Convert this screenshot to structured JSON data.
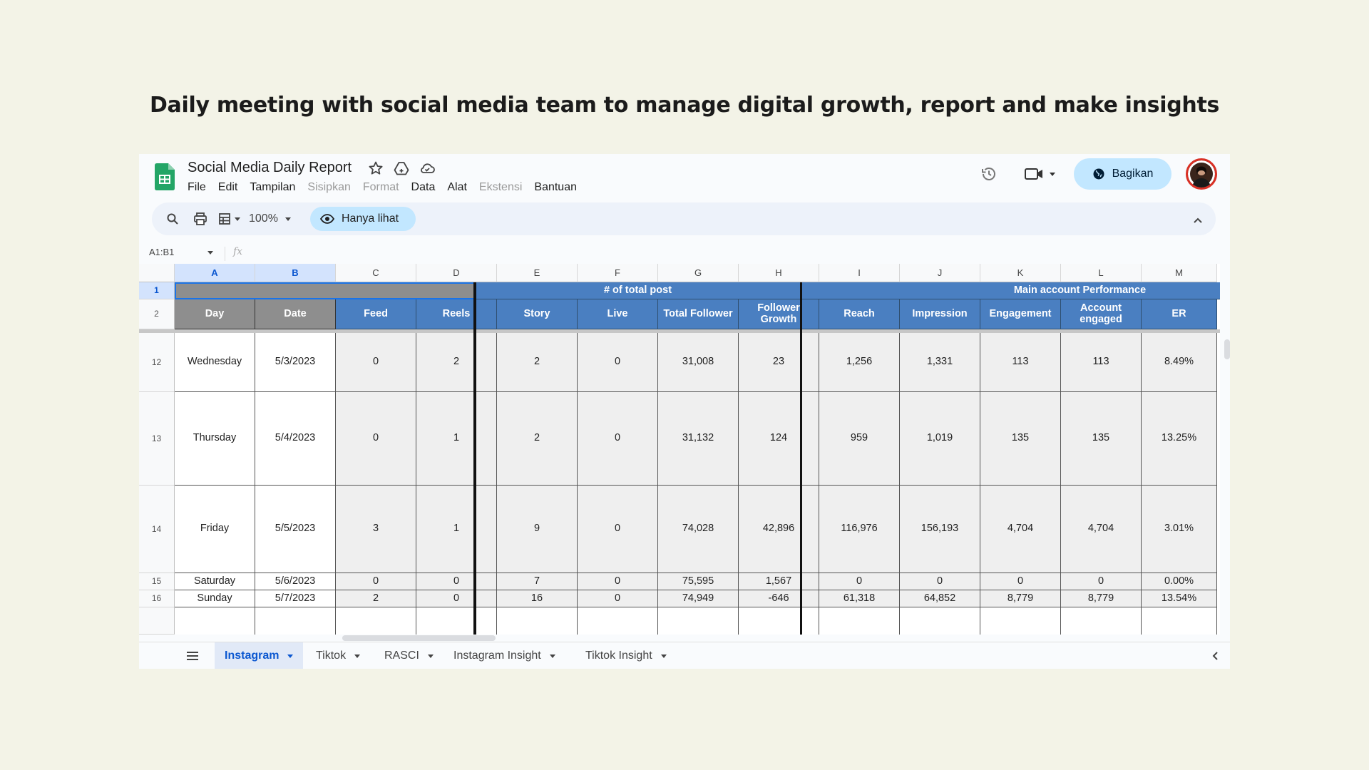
{
  "headline": "Daily meeting with social media team to manage digital growth, report and make insights",
  "app": {
    "doc_title": "Social Media Daily Report",
    "menus": [
      "File",
      "Edit",
      "Tampilan",
      "Sisipkan",
      "Format",
      "Data",
      "Alat",
      "Ekstensi",
      "Bantuan"
    ],
    "share_label": "Bagikan",
    "accent_color": "#c2e7ff",
    "header_icons": [
      "star-icon",
      "drive-icon",
      "cloud-icon",
      "history-icon",
      "video-icon"
    ]
  },
  "toolbar": {
    "zoom": "100%",
    "view_only_label": "Hanya lihat"
  },
  "formula_bar": {
    "name_box": "A1:B1",
    "fx_label": "fx"
  },
  "sheet": {
    "columns": [
      "A",
      "B",
      "C",
      "D",
      "E",
      "F",
      "G",
      "H",
      "I",
      "J",
      "K",
      "L",
      "M"
    ],
    "group_headers": {
      "posts": "# of total post",
      "performance": "Main account Performance"
    },
    "headers": [
      "Day",
      "Date",
      "Feed",
      "Reels",
      "Story",
      "Live",
      "Total Follower",
      "Follower Growth",
      "Reach",
      "Impression",
      "Engagement",
      "Account engaged",
      "ER"
    ],
    "header_row_numbers": [
      "1",
      "2"
    ],
    "rows": [
      {
        "num": "12",
        "cells": [
          "Wednesday",
          "5/3/2023",
          "0",
          "2",
          "2",
          "0",
          "31,008",
          "23",
          "1,256",
          "1,331",
          "113",
          "113",
          "8.49%"
        ]
      },
      {
        "num": "13",
        "cells": [
          "Thursday",
          "5/4/2023",
          "0",
          "1",
          "2",
          "0",
          "31,132",
          "124",
          "959",
          "1,019",
          "135",
          "135",
          "13.25%"
        ]
      },
      {
        "num": "14",
        "cells": [
          "Friday",
          "5/5/2023",
          "3",
          "1",
          "9",
          "0",
          "74,028",
          "42,896",
          "116,976",
          "156,193",
          "4,704",
          "4,704",
          "3.01%"
        ]
      },
      {
        "num": "15",
        "cells": [
          "Saturday",
          "5/6/2023",
          "0",
          "0",
          "7",
          "0",
          "75,595",
          "1,567",
          "0",
          "0",
          "0",
          "0",
          "0.00%"
        ]
      },
      {
        "num": "16",
        "cells": [
          "Sunday",
          "5/7/2023",
          "2",
          "0",
          "16",
          "0",
          "74,949",
          "-646",
          "61,318",
          "64,852",
          "8,779",
          "8,779",
          "13.54%"
        ]
      }
    ]
  },
  "tabs": [
    {
      "label": "Instagram",
      "active": true
    },
    {
      "label": "Tiktok",
      "active": false
    },
    {
      "label": "RASCI",
      "active": false
    },
    {
      "label": "Instagram Insight",
      "active": false
    },
    {
      "label": "Tiktok Insight",
      "active": false
    }
  ]
}
